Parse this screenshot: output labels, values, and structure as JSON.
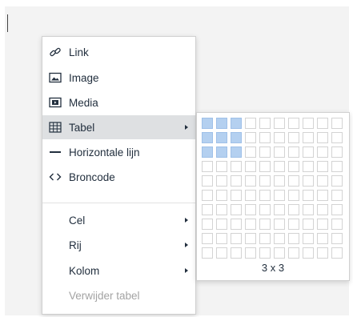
{
  "menu": {
    "items": [
      {
        "label": "Link",
        "icon": "link-icon"
      },
      {
        "label": "Image",
        "icon": "image-icon"
      },
      {
        "label": "Media",
        "icon": "media-icon"
      },
      {
        "label": "Tabel",
        "icon": "table-icon"
      },
      {
        "label": "Horizontale lijn",
        "icon": "horizontal-line-icon"
      },
      {
        "label": "Broncode",
        "icon": "code-icon"
      }
    ],
    "table_items": [
      {
        "label": "Cel"
      },
      {
        "label": "Rij"
      },
      {
        "label": "Kolom"
      },
      {
        "label": "Verwijder tabel"
      }
    ]
  },
  "table_picker": {
    "rows": 10,
    "cols": 10,
    "selected_rows": 3,
    "selected_cols": 3,
    "size_label": "3 x 3"
  },
  "colors": {
    "selected_cell": "#b4d0f0",
    "active_item": "#dee0e2",
    "disabled_text": "#a3a3a3"
  }
}
